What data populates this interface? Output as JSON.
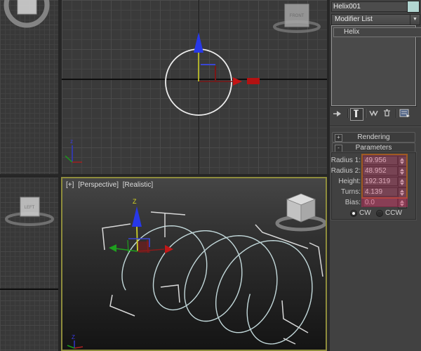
{
  "command_panel": {
    "name_field": {
      "value": "Helix001"
    },
    "object_color": "#b2d6d2",
    "modifier_dropdown": {
      "label": "Modifier List",
      "arrow": "▼"
    },
    "modifier_stack": {
      "items": [
        {
          "label": "Helix"
        }
      ]
    },
    "stack_toolbar": {
      "buttons": [
        "pin-stack",
        "show-end-result",
        "make-unique",
        "remove-modifier",
        "configure-modifier-sets"
      ]
    },
    "rollouts": [
      {
        "label": "Rendering",
        "toggle": "+",
        "expanded": false
      },
      {
        "label": "Parameters",
        "toggle": "-",
        "expanded": true
      }
    ],
    "parameters": {
      "rows": [
        {
          "label": "Radius 1:",
          "value": "49.956"
        },
        {
          "label": "Radius 2:",
          "value": "48.952"
        },
        {
          "label": "Height:",
          "value": "192.319"
        },
        {
          "label": "Turns:",
          "value": "4.139"
        },
        {
          "label": "Bias:",
          "value": "0.0"
        }
      ],
      "direction": {
        "cw_label": "CW",
        "ccw_label": "CCW",
        "selected": "CW"
      }
    }
  },
  "viewports": {
    "perspective": {
      "menu_general": "[+]",
      "menu_pov": "[Perspective]",
      "menu_shading": "[Realistic]",
      "gizmo_axis_label": "Z",
      "world_axis_label": "Z"
    },
    "top": {
      "world_axis_label": "z"
    },
    "viewcube_front_label": "FRONT",
    "viewcube_left_label": "LEFT"
  },
  "annotation": {
    "border": "#a05a22",
    "fill": "rgba(190,52,94,0.38)",
    "fill_strong": "rgba(196,46,92,0.5)"
  },
  "colors": {
    "active_viewport_border": "#8e8c3c",
    "helix_spline": "#c3d9db",
    "selected_object_circle": "#ededed"
  }
}
